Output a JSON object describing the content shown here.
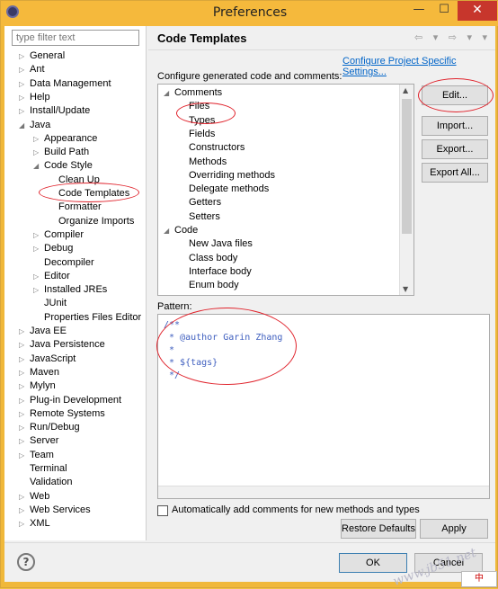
{
  "window": {
    "title": "Preferences",
    "controls": {
      "minimize": "—",
      "maximize": "☐",
      "close": "✕"
    }
  },
  "filter": {
    "placeholder": "type filter text"
  },
  "tree": [
    {
      "label": "General",
      "level": 0,
      "arrow": "▷"
    },
    {
      "label": "Ant",
      "level": 0,
      "arrow": "▷"
    },
    {
      "label": "Data Management",
      "level": 0,
      "arrow": "▷"
    },
    {
      "label": "Help",
      "level": 0,
      "arrow": "▷"
    },
    {
      "label": "Install/Update",
      "level": 0,
      "arrow": "▷"
    },
    {
      "label": "Java",
      "level": 0,
      "arrow": "◢"
    },
    {
      "label": "Appearance",
      "level": 1,
      "arrow": "▷"
    },
    {
      "label": "Build Path",
      "level": 1,
      "arrow": "▷"
    },
    {
      "label": "Code Style",
      "level": 1,
      "arrow": "◢"
    },
    {
      "label": "Clean Up",
      "level": 2,
      "arrow": ""
    },
    {
      "label": "Code Templates",
      "level": 2,
      "arrow": "",
      "selected": true
    },
    {
      "label": "Formatter",
      "level": 2,
      "arrow": ""
    },
    {
      "label": "Organize Imports",
      "level": 2,
      "arrow": ""
    },
    {
      "label": "Compiler",
      "level": 1,
      "arrow": "▷"
    },
    {
      "label": "Debug",
      "level": 1,
      "arrow": "▷"
    },
    {
      "label": "Decompiler",
      "level": 1,
      "arrow": ""
    },
    {
      "label": "Editor",
      "level": 1,
      "arrow": "▷"
    },
    {
      "label": "Installed JREs",
      "level": 1,
      "arrow": "▷"
    },
    {
      "label": "JUnit",
      "level": 1,
      "arrow": ""
    },
    {
      "label": "Properties Files Editor",
      "level": 1,
      "arrow": ""
    },
    {
      "label": "Java EE",
      "level": 0,
      "arrow": "▷"
    },
    {
      "label": "Java Persistence",
      "level": 0,
      "arrow": "▷"
    },
    {
      "label": "JavaScript",
      "level": 0,
      "arrow": "▷"
    },
    {
      "label": "Maven",
      "level": 0,
      "arrow": "▷"
    },
    {
      "label": "Mylyn",
      "level": 0,
      "arrow": "▷"
    },
    {
      "label": "Plug-in Development",
      "level": 0,
      "arrow": "▷"
    },
    {
      "label": "Remote Systems",
      "level": 0,
      "arrow": "▷"
    },
    {
      "label": "Run/Debug",
      "level": 0,
      "arrow": "▷"
    },
    {
      "label": "Server",
      "level": 0,
      "arrow": "▷"
    },
    {
      "label": "Team",
      "level": 0,
      "arrow": "▷"
    },
    {
      "label": "Terminal",
      "level": 0,
      "arrow": ""
    },
    {
      "label": "Validation",
      "level": 0,
      "arrow": ""
    },
    {
      "label": "Web",
      "level": 0,
      "arrow": "▷"
    },
    {
      "label": "Web Services",
      "level": 0,
      "arrow": "▷"
    },
    {
      "label": "XML",
      "level": 0,
      "arrow": "▷"
    }
  ],
  "page": {
    "title": "Code Templates",
    "nav_icons": "⇦ ▾ ⇨ ▾ ▾",
    "project_link": "Configure Project Specific Settings...",
    "configure_label": "Configure generated code and comments:",
    "pattern_label": "Pattern:",
    "auto_comments_label": "Automatically add comments for new methods and types"
  },
  "templates": [
    {
      "label": "Comments",
      "level": 0,
      "arrow": "◢"
    },
    {
      "label": "Files",
      "level": 1
    },
    {
      "label": "Types",
      "level": 1
    },
    {
      "label": "Fields",
      "level": 1
    },
    {
      "label": "Constructors",
      "level": 1
    },
    {
      "label": "Methods",
      "level": 1
    },
    {
      "label": "Overriding methods",
      "level": 1
    },
    {
      "label": "Delegate methods",
      "level": 1
    },
    {
      "label": "Getters",
      "level": 1
    },
    {
      "label": "Setters",
      "level": 1
    },
    {
      "label": "Code",
      "level": 0,
      "arrow": "◢"
    },
    {
      "label": "New Java files",
      "level": 1
    },
    {
      "label": "Class body",
      "level": 1
    },
    {
      "label": "Interface body",
      "level": 1
    },
    {
      "label": "Enum body",
      "level": 1
    }
  ],
  "side_buttons": {
    "edit": "Edit...",
    "import": "Import...",
    "export": "Export...",
    "export_all": "Export All..."
  },
  "pattern_lines": [
    "/**",
    " * @author Garin Zhang",
    " * ",
    " * ${tags}",
    " */"
  ],
  "bottom_buttons": {
    "restore": "Restore Defaults",
    "apply": "Apply",
    "ok": "OK",
    "cancel": "Cancel"
  },
  "watermark": "www.jb51.net",
  "ime": "中",
  "help": "?",
  "colors": {
    "annotation": "#e0232c",
    "link": "#0064c8",
    "javadoc": "#3f5fbf",
    "titlebar": "#f5b93c",
    "close": "#c7362c"
  }
}
